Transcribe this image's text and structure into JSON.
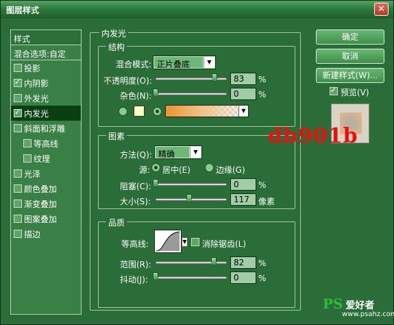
{
  "window": {
    "title": "图层样式",
    "close_glyph": "✕"
  },
  "style_list": {
    "header": "样式",
    "blend": "混合选项:自定",
    "items": [
      {
        "label": "投影",
        "checked": false,
        "sub": false,
        "active": false
      },
      {
        "label": "内阴影",
        "checked": true,
        "sub": false,
        "active": false
      },
      {
        "label": "外发光",
        "checked": false,
        "sub": false,
        "active": false
      },
      {
        "label": "内发光",
        "checked": true,
        "sub": false,
        "active": true
      },
      {
        "label": "斜面和浮雕",
        "checked": false,
        "sub": false,
        "active": false
      },
      {
        "label": "等高线",
        "checked": false,
        "sub": true,
        "active": false
      },
      {
        "label": "纹理",
        "checked": false,
        "sub": true,
        "active": false
      },
      {
        "label": "光泽",
        "checked": false,
        "sub": false,
        "active": false
      },
      {
        "label": "颜色叠加",
        "checked": false,
        "sub": false,
        "active": false
      },
      {
        "label": "渐变叠加",
        "checked": false,
        "sub": false,
        "active": false
      },
      {
        "label": "图案叠加",
        "checked": false,
        "sub": false,
        "active": false
      },
      {
        "label": "描边",
        "checked": false,
        "sub": false,
        "active": false
      }
    ]
  },
  "inner_glow": {
    "title": "内发光",
    "structure": {
      "title": "结构",
      "blend_mode_label": "混合模式:",
      "blend_mode_value": "正片叠底",
      "opacity_label": "不透明度(O):",
      "opacity_value": "83",
      "opacity_fraction": 0.83,
      "noise_label": "杂色(N):",
      "noise_value": "0",
      "noise_fraction": 0,
      "percent": "%",
      "glow_color": "#fdfbbd"
    },
    "elements": {
      "title": "图素",
      "technique_label": "方法(Q):",
      "technique_value": "精确",
      "source_label": "源:",
      "center_label": "居中(E)",
      "edge_label": "边缘(G)",
      "choke_label": "阻塞(C):",
      "choke_value": "0",
      "choke_fraction": 0,
      "size_label": "大小(S):",
      "size_value": "117",
      "size_fraction": 0.47,
      "size_unit": "像素",
      "percent": "%"
    },
    "quality": {
      "title": "品质",
      "contour_label": "等高线:",
      "anti_alias_label": "消除锯齿(L)",
      "range_label": "范围(R):",
      "range_value": "82",
      "range_fraction": 0.82,
      "jitter_label": "抖动(J):",
      "jitter_value": "0",
      "jitter_fraction": 0,
      "percent": "%"
    }
  },
  "buttons": {
    "ok": "确定",
    "cancel": "取消",
    "new_style": "新建样式(W)...",
    "preview_label": "预览(V)"
  },
  "watermark": "db901b",
  "logo": {
    "mark": "PS",
    "text": "爱好者",
    "url": "www.psahz.com"
  }
}
